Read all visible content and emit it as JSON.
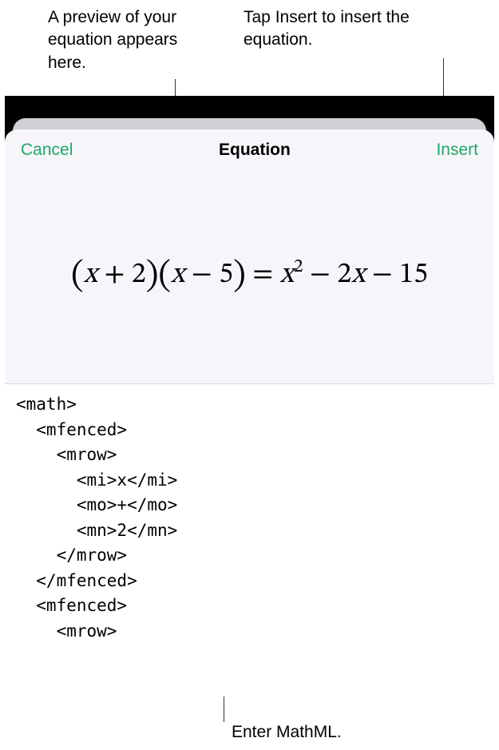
{
  "callouts": {
    "preview": "A preview of your equation appears here.",
    "insert": "Tap Insert to insert the equation.",
    "input": "Enter MathML."
  },
  "navbar": {
    "cancel": "Cancel",
    "title": "Equation",
    "insert": "Insert"
  },
  "preview_equation": {
    "lhs_factor1_var": "x",
    "lhs_factor1_op": "+",
    "lhs_factor1_num": "2",
    "lhs_factor2_var": "x",
    "lhs_factor2_op": "−",
    "lhs_factor2_num": "5",
    "eq": "=",
    "rhs_term1_base": "x",
    "rhs_term1_exp": "2",
    "rhs_op1": "−",
    "rhs_term2_coef": "2",
    "rhs_term2_var": "x",
    "rhs_op2": "−",
    "rhs_term3": "15"
  },
  "code_lines": {
    "l0": "<math>",
    "l1": "  <mfenced>",
    "l2": "    <mrow>",
    "l3": "      <mi>x</mi>",
    "l4": "      <mo>+</mo>",
    "l5": "      <mn>2</mn>",
    "l6": "    </mrow>",
    "l7": "  </mfenced>",
    "l8": "  <mfenced>",
    "l9": "    <mrow>"
  }
}
